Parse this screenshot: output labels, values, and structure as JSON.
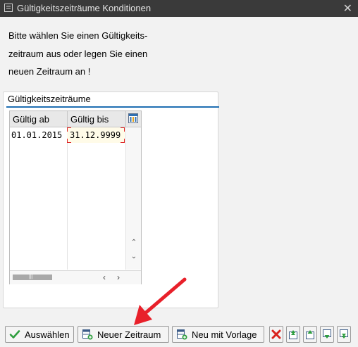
{
  "window": {
    "title": "Gültigkeitszeiträume Konditionen",
    "close_glyph": "✕"
  },
  "message": {
    "line1": "Bitte wählen Sie einen Gültigkeits-",
    "line2": "zeitraum aus oder legen Sie einen",
    "line3": "neuen Zeitraum an !"
  },
  "group": {
    "title": "Gültigkeitszeiträume",
    "table": {
      "columns": [
        "Gültig ab",
        "Gültig bis"
      ],
      "rows": [
        {
          "valid_from": "01.01.2015",
          "valid_to": "31.12.9999"
        }
      ]
    }
  },
  "toolbar": {
    "select_label": "Auswählen",
    "new_period_label": "Neuer Zeitraum",
    "new_with_template_label": "Neu mit Vorlage"
  },
  "icons": {
    "title": "window-icon",
    "column_config": "column-config-icon",
    "select": "checkmark-icon",
    "new_period": "new-period-icon",
    "new_template": "new-template-icon",
    "delete": "delete-icon",
    "first": "first-page-icon",
    "prev": "previous-page-icon",
    "next": "next-page-icon",
    "last": "last-page-icon"
  },
  "colors": {
    "accent": "#1f6fb2",
    "annotation_arrow": "#e8202a",
    "check_green": "#2e9e3e",
    "delete_red": "#d9231d"
  }
}
